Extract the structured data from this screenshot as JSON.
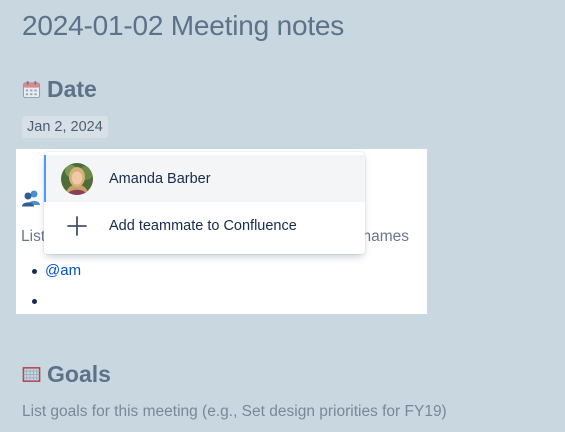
{
  "page": {
    "title": "2024-01-02 Meeting notes"
  },
  "date_section": {
    "heading": "Date",
    "icon": "calendar-icon",
    "date_value": "Jan 2, 2024"
  },
  "participants_section": {
    "icon": "people-icon",
    "instruction_start": "List",
    "instruction_end": "names",
    "items": [
      {
        "text": "@am"
      },
      {
        "text": ""
      }
    ]
  },
  "mention_dropdown": {
    "items": [
      {
        "label": "Amanda Barber",
        "icon": "avatar",
        "selected": true
      },
      {
        "label": "Add teammate to Confluence",
        "icon": "plus-icon",
        "selected": false
      }
    ]
  },
  "goals_section": {
    "heading": "Goals",
    "icon": "goal-net-icon",
    "description": "List goals for this meeting (e.g., Set design priorities for FY19)"
  },
  "colors": {
    "background": "#c9d8e0",
    "mention_link": "#0052cc",
    "selection_border": "#4c9aff"
  }
}
